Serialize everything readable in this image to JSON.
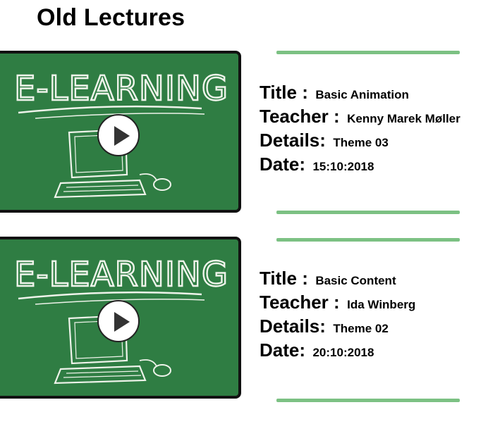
{
  "page": {
    "title": "Old Lectures"
  },
  "thumbnail": {
    "text": "E-LEARNING",
    "board_color": "#2f7d43",
    "chalk_color": "#eef3ea",
    "play_icon": "play-icon"
  },
  "divider_color": "#7cc183",
  "lectures": [
    {
      "title_label": "Title :",
      "title_value": "Basic Animation",
      "teacher_label": "Teacher :",
      "teacher_value": "Kenny Marek Møller",
      "details_label": "Details:",
      "details_value": "Theme 03",
      "date_label": "Date:",
      "date_value": "15:10:2018"
    },
    {
      "title_label": "Title :",
      "title_value": "Basic Content",
      "teacher_label": "Teacher :",
      "teacher_value": "Ida Winberg",
      "details_label": "Details:",
      "details_value": "Theme 02",
      "date_label": "Date:",
      "date_value": "20:10:2018"
    }
  ]
}
